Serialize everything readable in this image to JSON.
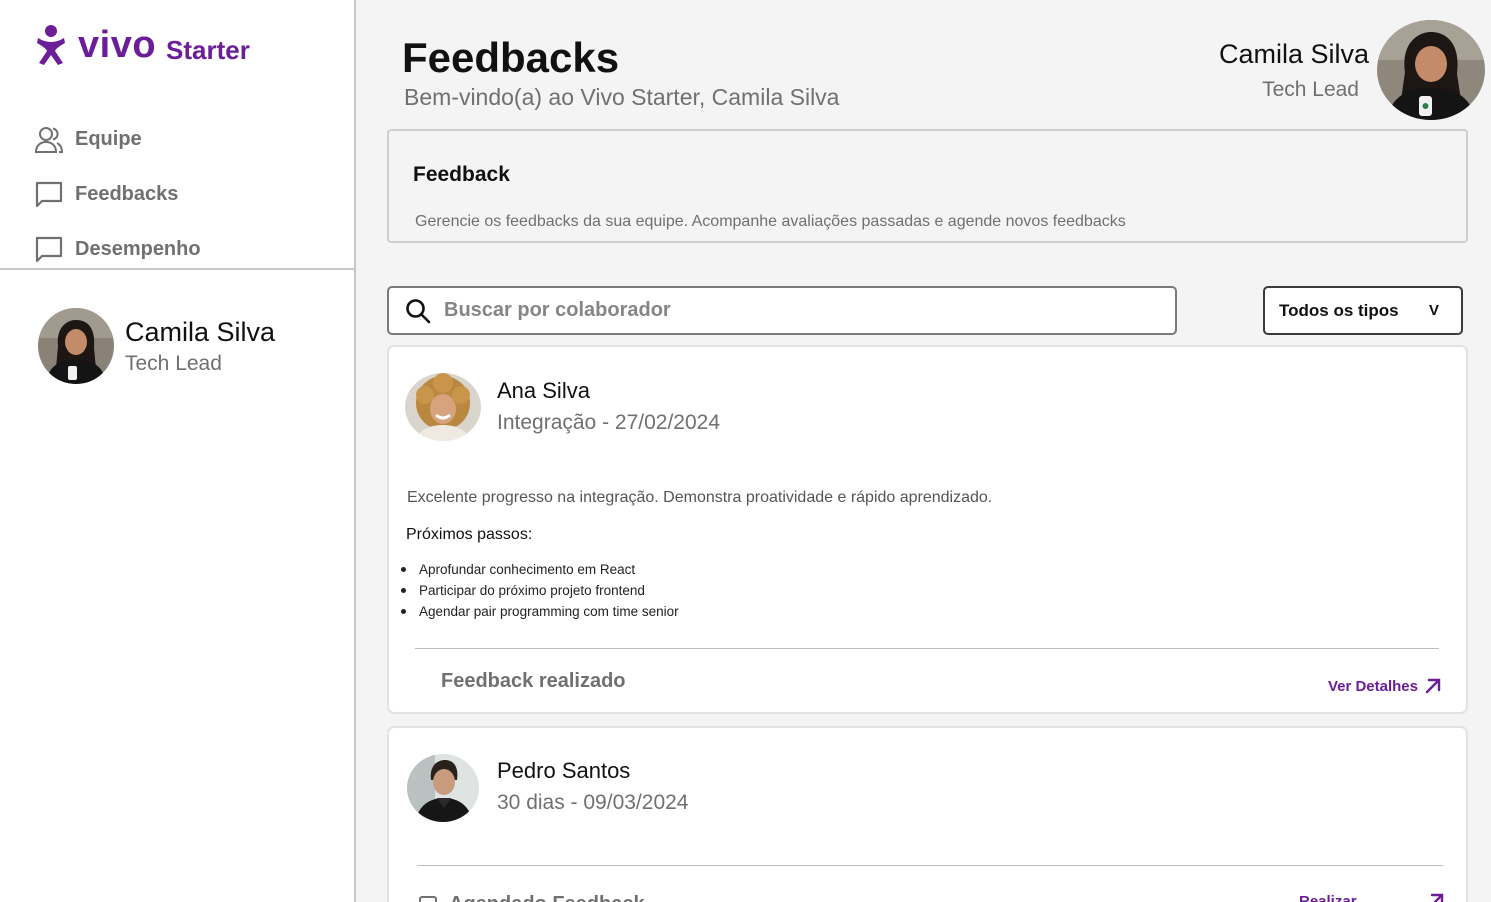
{
  "brand": {
    "name": "vivo",
    "product": "Starter",
    "color": "#6b1e97"
  },
  "sidebar": {
    "items": [
      {
        "label": "Equipe",
        "icon": "users-icon"
      },
      {
        "label": "Feedbacks",
        "icon": "message-square-icon"
      },
      {
        "label": "Desempenho",
        "icon": "message-square-icon"
      }
    ],
    "user": {
      "name": "Camila Silva",
      "role": "Tech Lead"
    }
  },
  "header": {
    "title": "Feedbacks",
    "subtitle": "Bem-vindo(a) ao Vivo Starter, Camila Silva",
    "user": {
      "name": "Camila Silva",
      "role": "Tech Lead"
    }
  },
  "panel": {
    "title": "Feedback",
    "description": "Gerencie os feedbacks da sua equipe. Acompanhe avaliações passadas e agende novos feedbacks"
  },
  "search": {
    "placeholder": "Buscar por colaborador",
    "value": ""
  },
  "filter": {
    "selected": "Todos os tipos",
    "chevron": "V"
  },
  "feedbacks": [
    {
      "name": "Ana Silva",
      "meta": "Integração - 27/02/2024",
      "text": "Excelente progresso na integração. Demonstra proatividade e rápido aprendizado.",
      "next_title": "Próximos passos:",
      "steps": [
        "Aprofundar conhecimento em React",
        "Participar do próximo projeto frontend",
        "Agendar pair programming com time senior"
      ],
      "status": "Feedback realizado",
      "action": "Ver Detalhes"
    },
    {
      "name": "Pedro Santos",
      "meta": "30 dias - 09/03/2024",
      "status": "Agendado Feedback",
      "action": "Realizar"
    }
  ]
}
